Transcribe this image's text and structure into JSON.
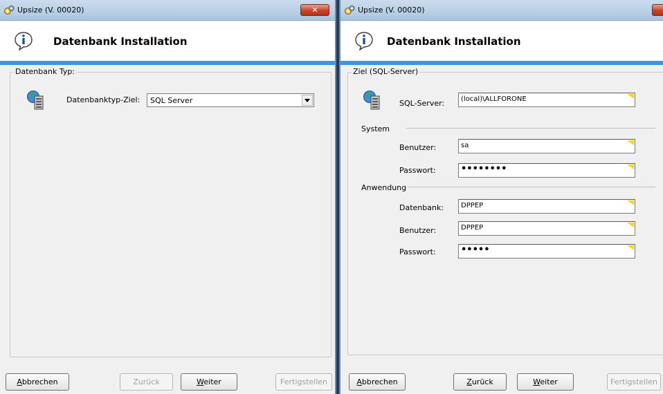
{
  "windows": [
    {
      "title": "Upsize (V. 00020)",
      "header_title": "Datenbank Installation",
      "group_label": "Datenbank Typ:",
      "db_type_label": "Datenbanktyp-Ziel:",
      "db_type_value": "SQL Server",
      "buttons": {
        "cancel": "Abbrechen",
        "back": "Zurück",
        "next": "Weiter",
        "finish": "Fertigstellen"
      }
    },
    {
      "title": "Upsize (V. 00020)",
      "header_title": "Datenbank Installation",
      "group_label": "Ziel (SQL-Server)",
      "sql_server_label": "SQL-Server:",
      "sql_server_value": "(local)\\ALLFORONE",
      "system_section": "System",
      "system_user_label": "Benutzer:",
      "system_user_value": "sa",
      "system_password_label": "Passwort:",
      "system_password_mask": "••••••••",
      "app_section": "Anwendung",
      "app_db_label": "Datenbank:",
      "app_db_value": "DPPEP",
      "app_user_label": "Benutzer:",
      "app_user_value": "DPPEP",
      "app_password_label": "Passwort:",
      "app_password_mask": "•••••",
      "buttons": {
        "cancel": "Abbrechen",
        "back": "Zurück",
        "next": "Weiter",
        "finish": "Fertigstellen"
      }
    }
  ],
  "colors": {
    "header_band": "#3d96e1",
    "field_corner": "#ffd800",
    "close_button": "#c7452b"
  },
  "icons": [
    "gears-app-icon",
    "info-icon",
    "database-server-icon",
    "close-icon",
    "dropdown-arrow-icon"
  ]
}
